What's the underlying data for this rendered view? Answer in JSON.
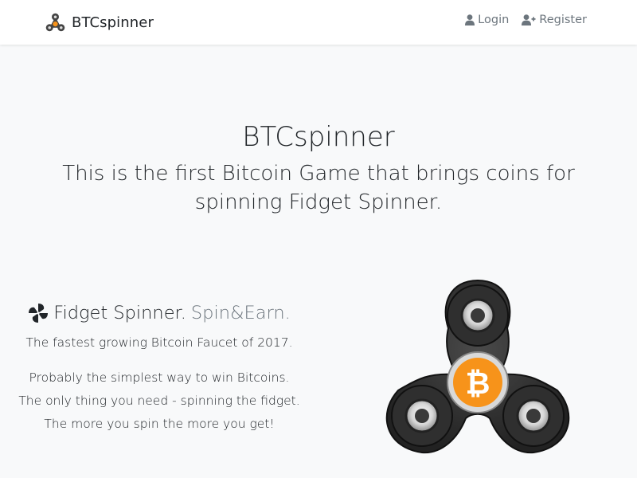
{
  "navbar": {
    "brand": "BTCspinner",
    "login_label": "Login",
    "register_label": "Register"
  },
  "hero": {
    "title": "BTCspinner",
    "subtitle": "This is the first Bitcoin Game that brings coins for spinning Fidget Spinner."
  },
  "feature": {
    "heading_main": "Fidget Spinner.",
    "heading_muted": "Spin&Earn.",
    "tagline": "The fastest growing Bitcoin Faucet of 2017.",
    "lines": [
      "Probably the simplest way to win Bitcoins.",
      "The only thing you need - spinning the fidget.",
      "The more you spin the more you get!"
    ]
  },
  "icons": {
    "brand": "fidget-spinner-logo-icon",
    "login": "user-icon",
    "register": "user-plus-icon",
    "feature": "pinwheel-icon",
    "hero_image": "fidget-spinner-bitcoin-image"
  },
  "colors": {
    "background": "#f8f9fa",
    "navbar": "#ffffff",
    "text": "#212529",
    "muted": "#6c757d",
    "bitcoin_orange": "#f7931a",
    "spinner_body": "#3a3a3a"
  }
}
